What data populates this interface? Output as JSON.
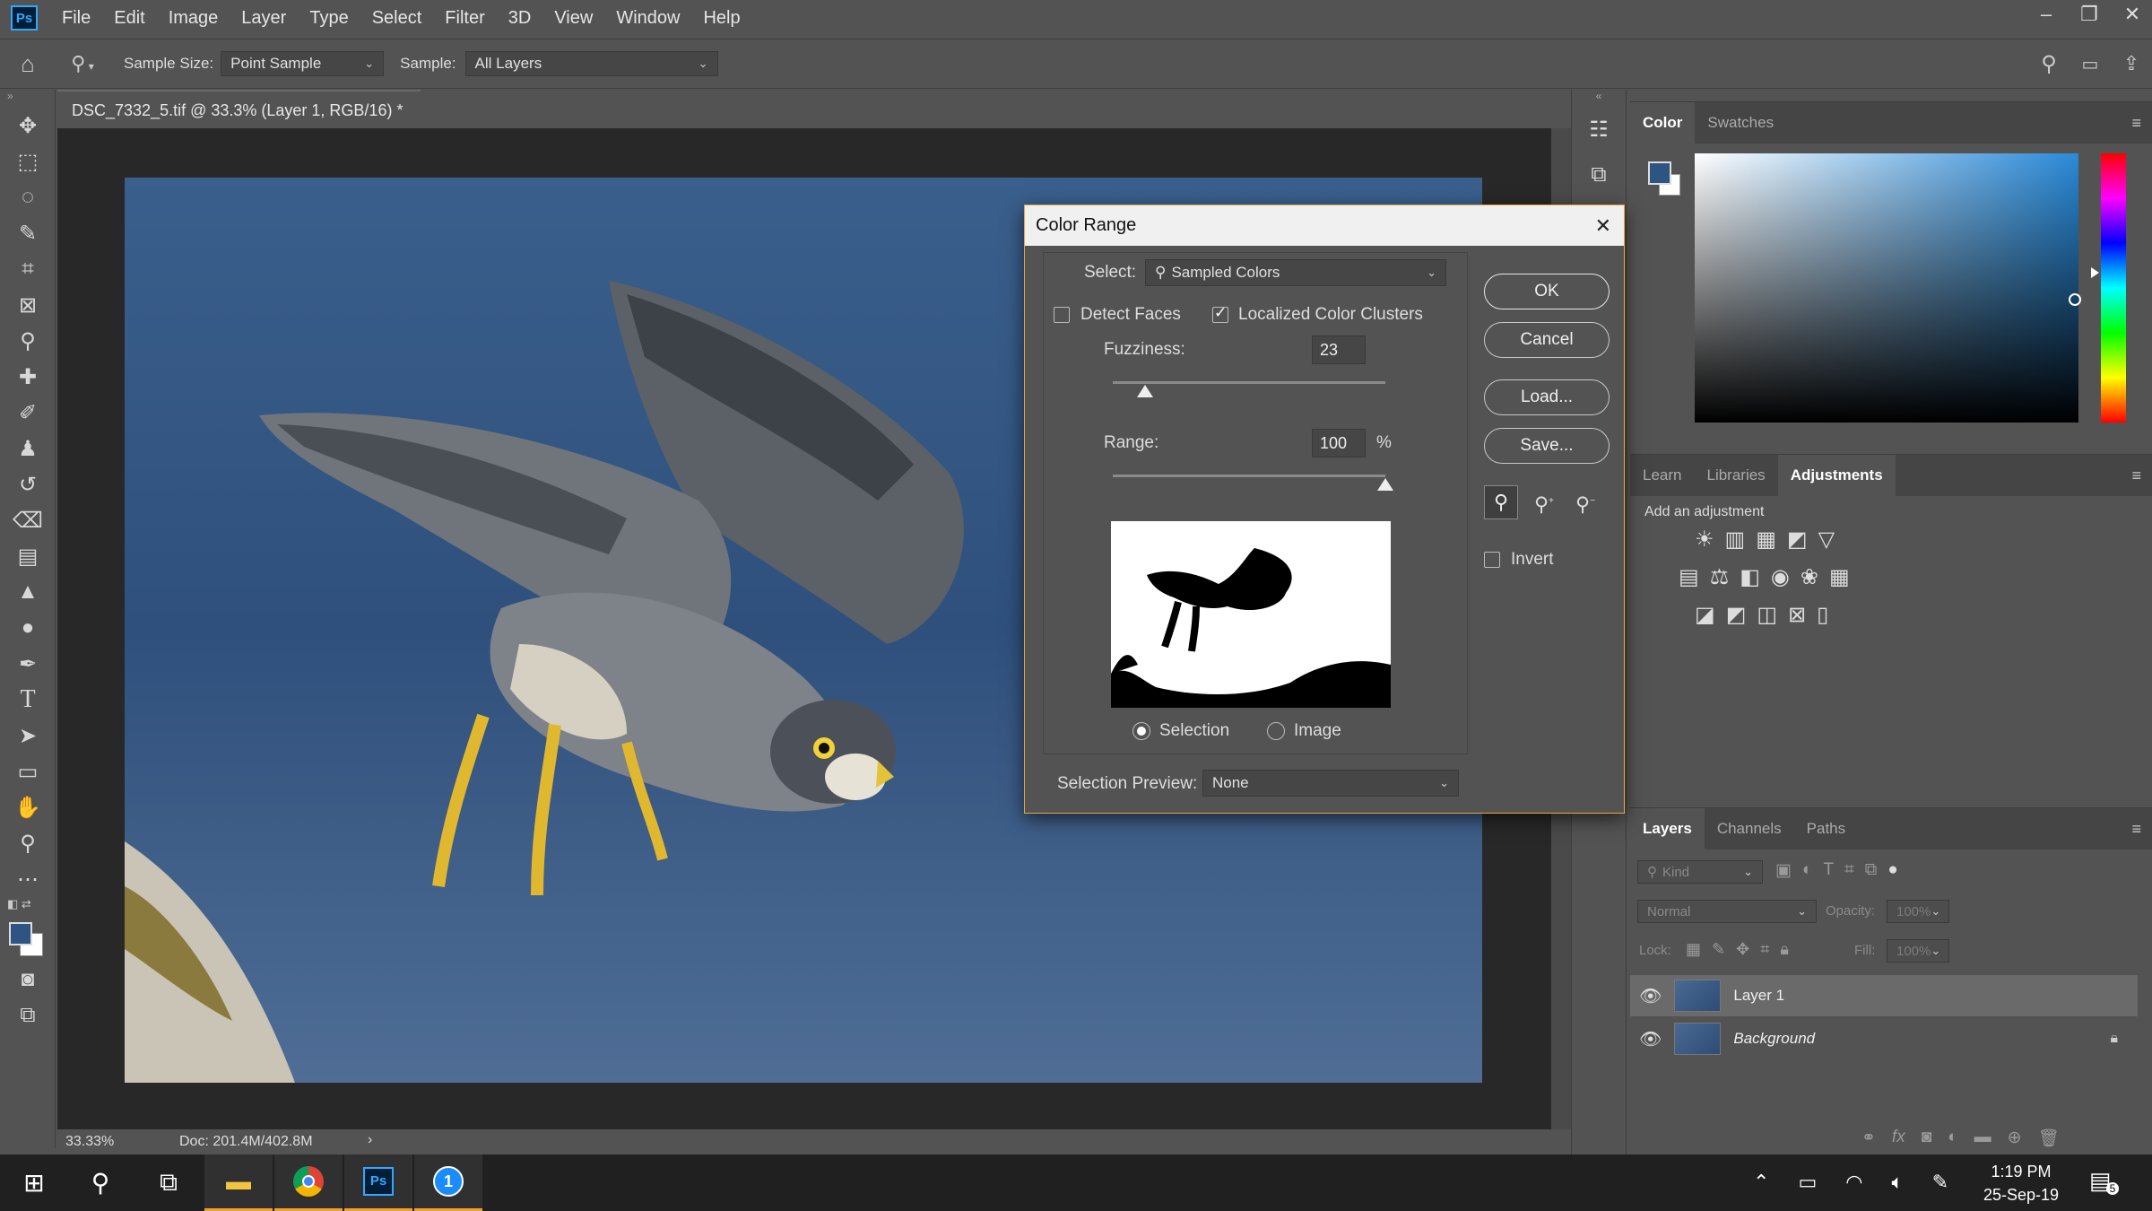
{
  "app": {
    "logo": "Ps",
    "menu": [
      "File",
      "Edit",
      "Image",
      "Layer",
      "Type",
      "Select",
      "Filter",
      "3D",
      "View",
      "Window",
      "Help"
    ]
  },
  "window_controls": {
    "minimize": "–",
    "restore": "❐",
    "close": "✕"
  },
  "options_bar": {
    "sample_size_label": "Sample Size:",
    "sample_size_value": "Point Sample",
    "sample_label": "Sample:",
    "sample_value": "All Layers"
  },
  "document": {
    "tab_title": "DSC_7332_5.tif @ 33.3% (Layer 1, RGB/16) *",
    "tab_close": "×",
    "zoom": "33.33%",
    "doc_size": "Doc: 201.4M/402.8M",
    "status_arrow": "›"
  },
  "dialog": {
    "title": "Color Range",
    "close": "✕",
    "select_label": "Select:",
    "select_value": "Sampled Colors",
    "detect_faces": "Detect Faces",
    "detect_faces_checked": false,
    "localized": "Localized Color Clusters",
    "localized_checked": true,
    "fuzziness_label": "Fuzziness:",
    "fuzziness_value": "23",
    "fuzziness_fraction": 0.12,
    "range_label": "Range:",
    "range_value": "100",
    "range_unit": "%",
    "range_fraction": 1.0,
    "radio_selection": "Selection",
    "radio_image": "Image",
    "selected_radio": "Selection",
    "preview_label": "Selection Preview:",
    "preview_value": "None",
    "ok": "OK",
    "cancel": "Cancel",
    "load": "Load...",
    "save": "Save...",
    "invert": "Invert",
    "invert_checked": false
  },
  "color_panel": {
    "tabs": [
      "Color",
      "Swatches"
    ],
    "active": "Color",
    "fg": "#2d5483",
    "bg": "#ffffff"
  },
  "adjust_panel": {
    "tabs": [
      "Learn",
      "Libraries",
      "Adjustments"
    ],
    "active": "Adjustments",
    "hint": "Add an adjustment"
  },
  "layers_panel": {
    "tabs": [
      "Layers",
      "Channels",
      "Paths"
    ],
    "active": "Layers",
    "kind": "Kind",
    "blend": "Normal",
    "opacity_label": "Opacity:",
    "opacity_value": "100%",
    "lock_label": "Lock:",
    "fill_label": "Fill:",
    "fill_value": "100%",
    "layers": [
      {
        "name": "Layer 1",
        "selected": true,
        "locked": false
      },
      {
        "name": "Background",
        "selected": false,
        "locked": true
      }
    ]
  },
  "taskbar": {
    "time": "1:19 PM",
    "date": "25-Sep-19",
    "notifications": "5"
  }
}
